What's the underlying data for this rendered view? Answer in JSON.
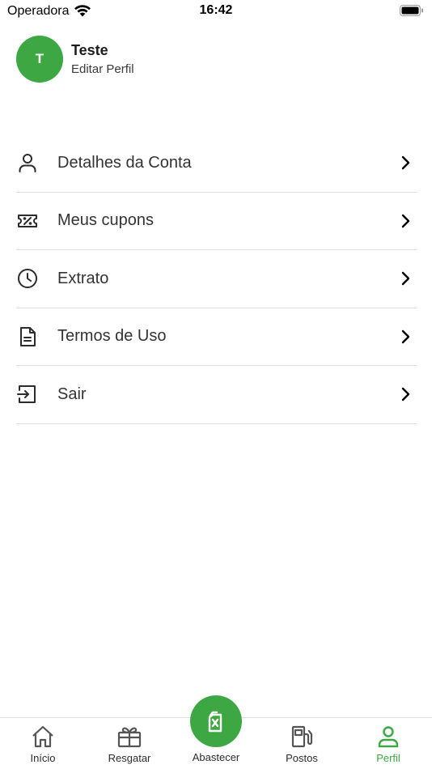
{
  "status_bar": {
    "carrier": "Operadora",
    "time": "16:42"
  },
  "profile": {
    "initial": "T",
    "name": "Teste",
    "edit_label": "Editar Perfil"
  },
  "menu": {
    "items": [
      {
        "label": "Detalhes da Conta",
        "icon": "user-icon"
      },
      {
        "label": "Meus cupons",
        "icon": "coupon-icon"
      },
      {
        "label": "Extrato",
        "icon": "clock-icon"
      },
      {
        "label": "Termos de Uso",
        "icon": "document-icon"
      },
      {
        "label": "Sair",
        "icon": "logout-icon"
      }
    ]
  },
  "tab_bar": {
    "tabs": [
      {
        "label": "Início",
        "icon": "home-icon"
      },
      {
        "label": "Resgatar",
        "icon": "gift-icon"
      },
      {
        "label": "Abastecer",
        "icon": "fuel-can-icon"
      },
      {
        "label": "Postos",
        "icon": "gas-station-icon"
      },
      {
        "label": "Perfil",
        "icon": "user-icon"
      }
    ],
    "active": "Perfil"
  },
  "colors": {
    "accent": "#3da843",
    "text": "#333333",
    "divider": "#dedede"
  }
}
